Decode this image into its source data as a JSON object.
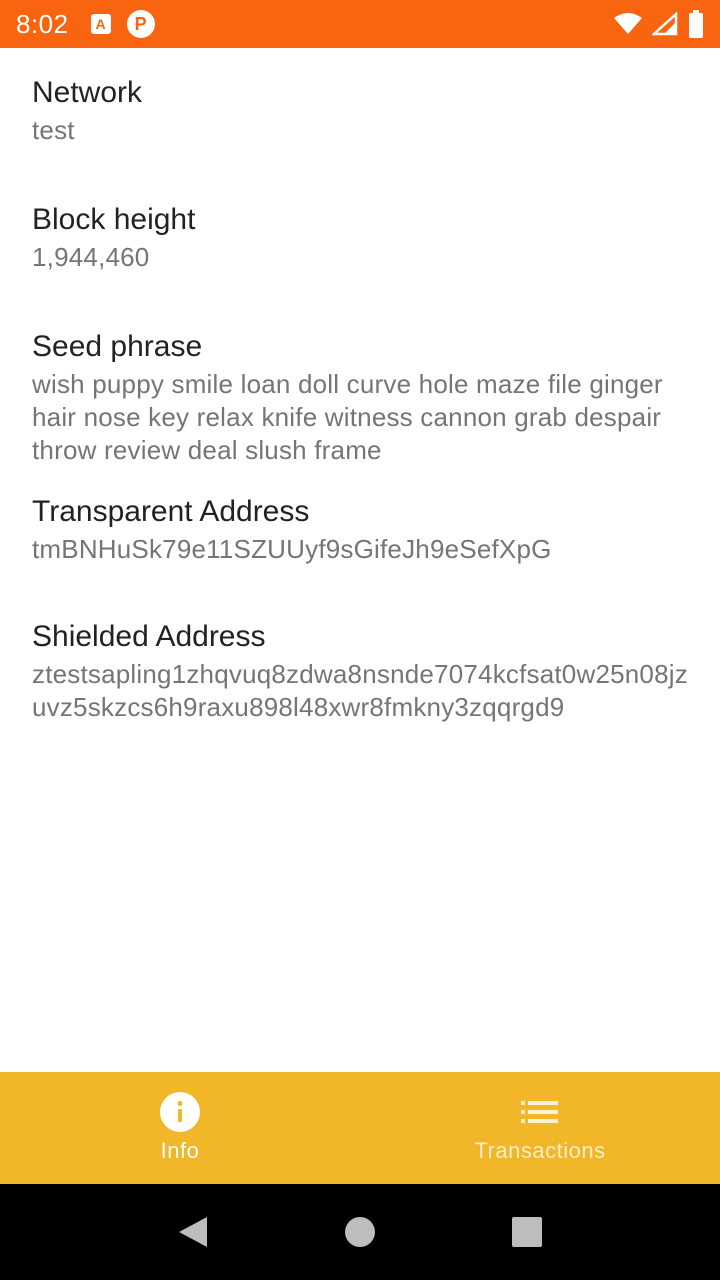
{
  "status_bar": {
    "time": "8:02",
    "notifications": [
      "a-notification-icon",
      "p-notification-icon"
    ],
    "indicators": [
      "wifi-icon",
      "signal-icon",
      "battery-icon"
    ],
    "color": "#f96410"
  },
  "info": {
    "network": {
      "label": "Network",
      "value": "test"
    },
    "block_height": {
      "label": "Block height",
      "value": "1,944,460"
    },
    "seed_phrase": {
      "label": "Seed phrase",
      "value": "wish puppy smile loan doll curve hole maze file ginger hair nose key relax knife witness cannon grab despair throw review deal slush frame"
    },
    "transparent_address": {
      "label": "Transparent Address",
      "value": "tmBNHuSk79e11SZUUyf9sGifeJh9eSefXpG"
    },
    "shielded_address": {
      "label": "Shielded Address",
      "value": "ztestsapling1zhqvuq8zdwa8nsnde7074kcfsat0w25n08jzuvz5skzcs6h9raxu898l48xwr8fmkny3zqqrgd9"
    }
  },
  "bottom_nav": {
    "color": "#f2b629",
    "items": [
      {
        "label": "Info",
        "icon": "info-icon",
        "active": true
      },
      {
        "label": "Transactions",
        "icon": "list-icon",
        "active": false
      }
    ]
  },
  "system_nav": [
    "back-icon",
    "home-icon",
    "recents-icon"
  ]
}
